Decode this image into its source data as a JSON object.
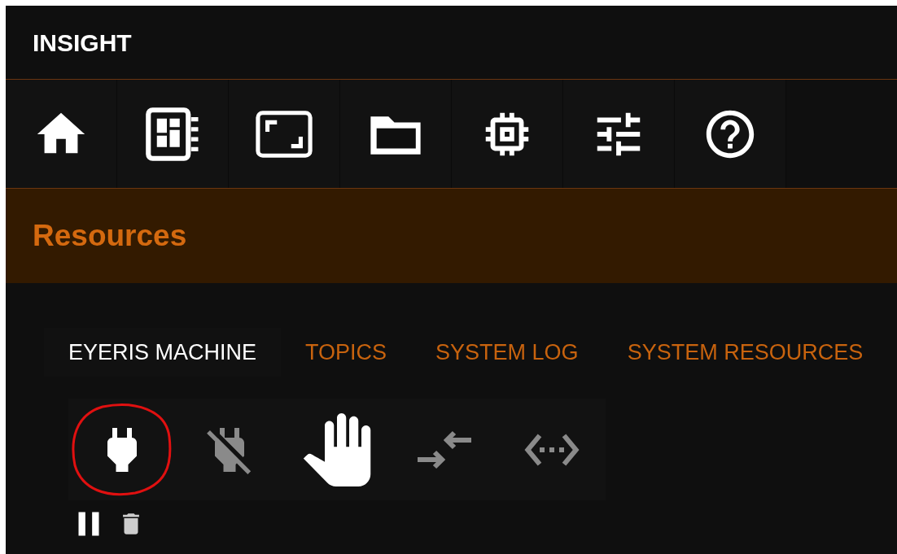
{
  "app_title": "INSIGHT",
  "toolbar": [
    {
      "kind": "home"
    },
    {
      "kind": "dashboard"
    },
    {
      "kind": "fullscreen"
    },
    {
      "kind": "folder"
    },
    {
      "kind": "chip"
    },
    {
      "kind": "tune"
    },
    {
      "kind": "help"
    }
  ],
  "section_title": "Resources",
  "tabs": [
    {
      "label": "EYERIS MACHINE",
      "selected": true
    },
    {
      "label": "TOPICS",
      "selected": false
    },
    {
      "label": "SYSTEM LOG",
      "selected": false
    },
    {
      "label": "SYSTEM RESOURCES",
      "selected": false
    }
  ],
  "actions": [
    {
      "kind": "connect",
      "disabled": false,
      "circled": true
    },
    {
      "kind": "disconnect",
      "disabled": true,
      "circled": false
    },
    {
      "kind": "stop",
      "disabled": false,
      "circled": false
    },
    {
      "kind": "exchange",
      "disabled": true,
      "circled": false
    },
    {
      "kind": "code",
      "disabled": true,
      "circled": false
    }
  ],
  "log_controls": [
    {
      "kind": "pause"
    },
    {
      "kind": "delete"
    }
  ]
}
